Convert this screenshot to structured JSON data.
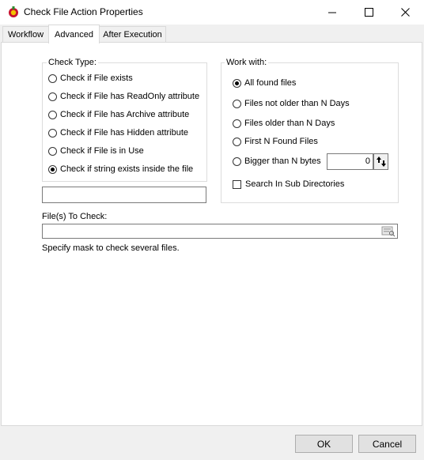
{
  "window": {
    "title": "Check File Action Properties"
  },
  "tabs": [
    {
      "label": "Workflow",
      "active": false
    },
    {
      "label": "Advanced",
      "active": true
    },
    {
      "label": "After Execution",
      "active": false
    }
  ],
  "check_type": {
    "label": "Check Type:",
    "options": [
      {
        "label": "Check if File exists",
        "selected": false
      },
      {
        "label": "Check if File has ReadOnly attribute",
        "selected": false
      },
      {
        "label": "Check if File has Archive attribute",
        "selected": false
      },
      {
        "label": "Check if File has Hidden attribute",
        "selected": false
      },
      {
        "label": "Check if File is in Use",
        "selected": false
      },
      {
        "label": "Check if string exists inside the file",
        "selected": true
      }
    ],
    "string_value": ""
  },
  "work_with": {
    "label": "Work with:",
    "options": [
      {
        "label": "All found files",
        "selected": true
      },
      {
        "label": "Files not older than N Days",
        "selected": false
      },
      {
        "label": "Files older than N Days",
        "selected": false
      },
      {
        "label": "First N Found Files",
        "selected": false
      },
      {
        "label": "Bigger than N bytes",
        "selected": false
      }
    ],
    "bytes_value": "0",
    "search_subdirs_label": "Search In Sub Directories",
    "search_subdirs_checked": false
  },
  "files_to_check": {
    "label": "File(s) To Check:",
    "value": "",
    "hint": "Specify mask to check several files."
  },
  "footer": {
    "ok_label": "OK",
    "cancel_label": "Cancel"
  },
  "colors": {
    "selection_dot": "#000000",
    "panel": "#ffffff",
    "chrome": "#f0f0f0"
  }
}
